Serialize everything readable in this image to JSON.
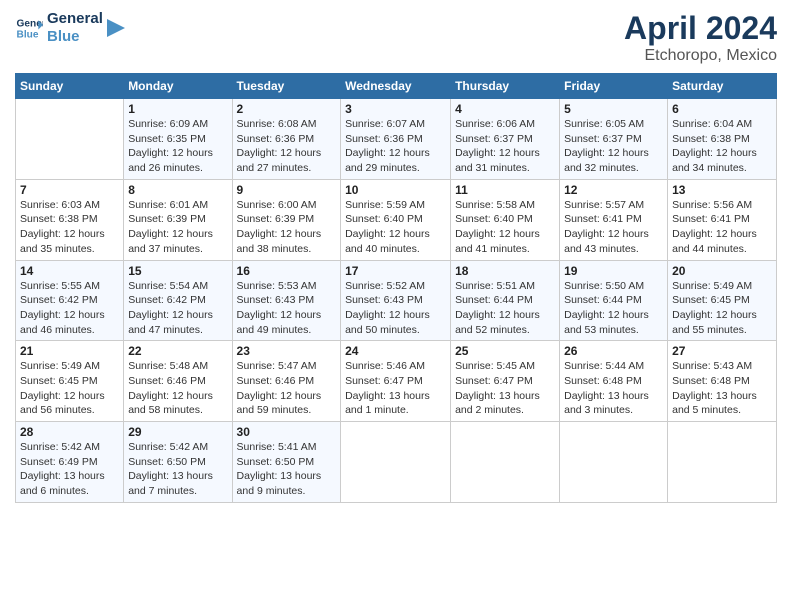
{
  "logo": {
    "text_general": "General",
    "text_blue": "Blue"
  },
  "title": "April 2024",
  "subtitle": "Etchoropo, Mexico",
  "days_of_week": [
    "Sunday",
    "Monday",
    "Tuesday",
    "Wednesday",
    "Thursday",
    "Friday",
    "Saturday"
  ],
  "weeks": [
    [
      {
        "day": "",
        "info": ""
      },
      {
        "day": "1",
        "info": "Sunrise: 6:09 AM\nSunset: 6:35 PM\nDaylight: 12 hours\nand 26 minutes."
      },
      {
        "day": "2",
        "info": "Sunrise: 6:08 AM\nSunset: 6:36 PM\nDaylight: 12 hours\nand 27 minutes."
      },
      {
        "day": "3",
        "info": "Sunrise: 6:07 AM\nSunset: 6:36 PM\nDaylight: 12 hours\nand 29 minutes."
      },
      {
        "day": "4",
        "info": "Sunrise: 6:06 AM\nSunset: 6:37 PM\nDaylight: 12 hours\nand 31 minutes."
      },
      {
        "day": "5",
        "info": "Sunrise: 6:05 AM\nSunset: 6:37 PM\nDaylight: 12 hours\nand 32 minutes."
      },
      {
        "day": "6",
        "info": "Sunrise: 6:04 AM\nSunset: 6:38 PM\nDaylight: 12 hours\nand 34 minutes."
      }
    ],
    [
      {
        "day": "7",
        "info": "Sunrise: 6:03 AM\nSunset: 6:38 PM\nDaylight: 12 hours\nand 35 minutes."
      },
      {
        "day": "8",
        "info": "Sunrise: 6:01 AM\nSunset: 6:39 PM\nDaylight: 12 hours\nand 37 minutes."
      },
      {
        "day": "9",
        "info": "Sunrise: 6:00 AM\nSunset: 6:39 PM\nDaylight: 12 hours\nand 38 minutes."
      },
      {
        "day": "10",
        "info": "Sunrise: 5:59 AM\nSunset: 6:40 PM\nDaylight: 12 hours\nand 40 minutes."
      },
      {
        "day": "11",
        "info": "Sunrise: 5:58 AM\nSunset: 6:40 PM\nDaylight: 12 hours\nand 41 minutes."
      },
      {
        "day": "12",
        "info": "Sunrise: 5:57 AM\nSunset: 6:41 PM\nDaylight: 12 hours\nand 43 minutes."
      },
      {
        "day": "13",
        "info": "Sunrise: 5:56 AM\nSunset: 6:41 PM\nDaylight: 12 hours\nand 44 minutes."
      }
    ],
    [
      {
        "day": "14",
        "info": "Sunrise: 5:55 AM\nSunset: 6:42 PM\nDaylight: 12 hours\nand 46 minutes."
      },
      {
        "day": "15",
        "info": "Sunrise: 5:54 AM\nSunset: 6:42 PM\nDaylight: 12 hours\nand 47 minutes."
      },
      {
        "day": "16",
        "info": "Sunrise: 5:53 AM\nSunset: 6:43 PM\nDaylight: 12 hours\nand 49 minutes."
      },
      {
        "day": "17",
        "info": "Sunrise: 5:52 AM\nSunset: 6:43 PM\nDaylight: 12 hours\nand 50 minutes."
      },
      {
        "day": "18",
        "info": "Sunrise: 5:51 AM\nSunset: 6:44 PM\nDaylight: 12 hours\nand 52 minutes."
      },
      {
        "day": "19",
        "info": "Sunrise: 5:50 AM\nSunset: 6:44 PM\nDaylight: 12 hours\nand 53 minutes."
      },
      {
        "day": "20",
        "info": "Sunrise: 5:49 AM\nSunset: 6:45 PM\nDaylight: 12 hours\nand 55 minutes."
      }
    ],
    [
      {
        "day": "21",
        "info": "Sunrise: 5:49 AM\nSunset: 6:45 PM\nDaylight: 12 hours\nand 56 minutes."
      },
      {
        "day": "22",
        "info": "Sunrise: 5:48 AM\nSunset: 6:46 PM\nDaylight: 12 hours\nand 58 minutes."
      },
      {
        "day": "23",
        "info": "Sunrise: 5:47 AM\nSunset: 6:46 PM\nDaylight: 12 hours\nand 59 minutes."
      },
      {
        "day": "24",
        "info": "Sunrise: 5:46 AM\nSunset: 6:47 PM\nDaylight: 13 hours\nand 1 minute."
      },
      {
        "day": "25",
        "info": "Sunrise: 5:45 AM\nSunset: 6:47 PM\nDaylight: 13 hours\nand 2 minutes."
      },
      {
        "day": "26",
        "info": "Sunrise: 5:44 AM\nSunset: 6:48 PM\nDaylight: 13 hours\nand 3 minutes."
      },
      {
        "day": "27",
        "info": "Sunrise: 5:43 AM\nSunset: 6:48 PM\nDaylight: 13 hours\nand 5 minutes."
      }
    ],
    [
      {
        "day": "28",
        "info": "Sunrise: 5:42 AM\nSunset: 6:49 PM\nDaylight: 13 hours\nand 6 minutes."
      },
      {
        "day": "29",
        "info": "Sunrise: 5:42 AM\nSunset: 6:50 PM\nDaylight: 13 hours\nand 7 minutes."
      },
      {
        "day": "30",
        "info": "Sunrise: 5:41 AM\nSunset: 6:50 PM\nDaylight: 13 hours\nand 9 minutes."
      },
      {
        "day": "",
        "info": ""
      },
      {
        "day": "",
        "info": ""
      },
      {
        "day": "",
        "info": ""
      },
      {
        "day": "",
        "info": ""
      }
    ]
  ]
}
